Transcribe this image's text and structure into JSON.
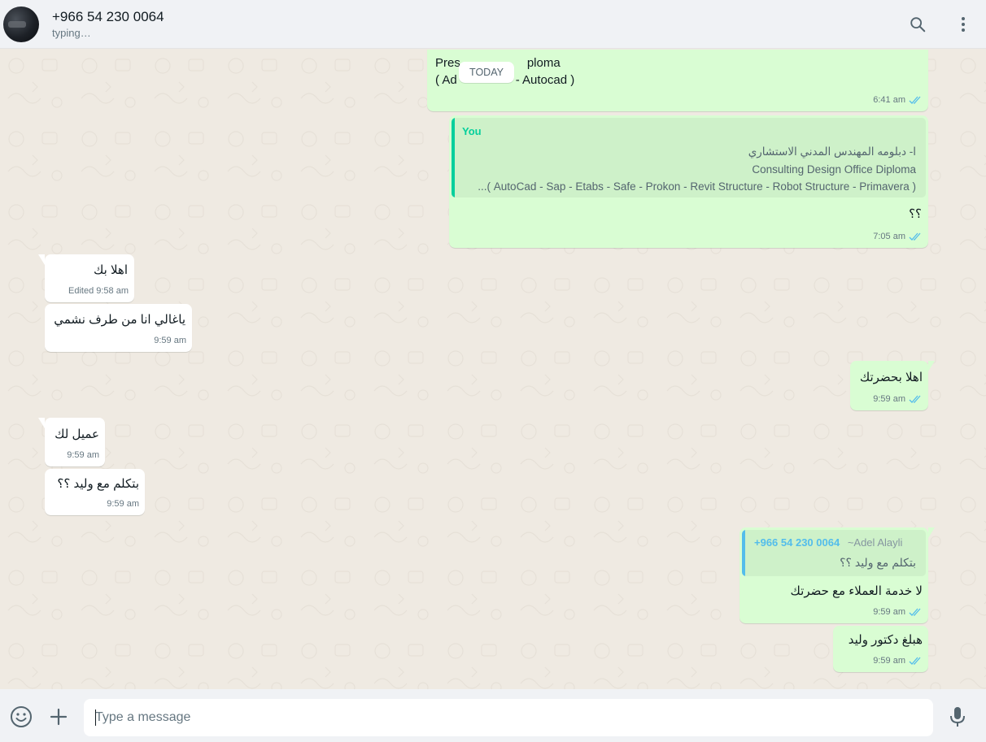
{
  "header": {
    "contact_name": "+966 54 230 0064",
    "status": "typing…",
    "icons": [
      "search-icon",
      "menu-icon"
    ]
  },
  "date_chip": "TODAY",
  "messages": {
    "m1": {
      "line1": "Pres",
      "line1b": "ploma",
      "line2a": "( Ad",
      "line2b": "- Autocad  )",
      "time": "6:41 am"
    },
    "m2": {
      "quote_author": "You",
      "quote_line1": "ا- دبلومه المهندس المدني الاستشاري",
      "quote_line2": "Consulting Design Office Diploma",
      "quote_line3": "( AutoCad - Sap - Etabs - Safe - Prokon - Revit Structure - Robot Structure - Primavera )...",
      "text": "؟؟",
      "time": "7:05 am"
    },
    "m3": {
      "text": "اهلا بك",
      "time": "Edited 9:58 am"
    },
    "m4": {
      "text": "ياغالي انا من طرف نشمي",
      "time": "9:59 am"
    },
    "m5": {
      "text": "اهلا بحضرتك",
      "time": "9:59 am"
    },
    "m6": {
      "text": "عميل لك",
      "time": "9:59 am"
    },
    "m7": {
      "text": "بتكلم مع وليد ؟؟",
      "time": "9:59 am"
    },
    "m8": {
      "quote_author": "+966 54 230 0064",
      "quote_alias": "~Adel Alayli",
      "quote_text": "بتكلم مع وليد ؟؟",
      "text": "لا خدمة العملاء مع حضرتك",
      "time": "9:59 am"
    },
    "m9": {
      "text": "هبلغ دكتور وليد",
      "time": "9:59 am"
    }
  },
  "composer": {
    "placeholder": "Type a message",
    "icons": [
      "emoji-icon",
      "attach-plus-icon",
      "microphone-icon"
    ]
  },
  "colors": {
    "outgoing_bubble": "#d9fdd3",
    "incoming_bubble": "#ffffff",
    "read_ticks": "#53bdeb",
    "quote_you": "#06cf9c",
    "quote_other": "#53bdeb"
  }
}
